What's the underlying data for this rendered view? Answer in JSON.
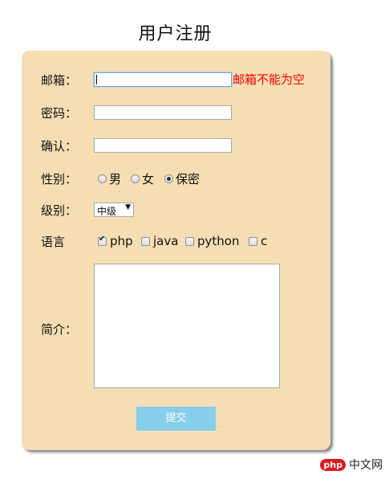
{
  "title": "用户注册",
  "form": {
    "email": {
      "label": "邮箱：",
      "value": "",
      "error": "邮箱不能为空"
    },
    "password": {
      "label": "密码：",
      "value": ""
    },
    "confirm": {
      "label": "确认：",
      "value": ""
    },
    "gender": {
      "label": "性别：",
      "options": [
        {
          "label": "男",
          "checked": false
        },
        {
          "label": "女",
          "checked": false
        },
        {
          "label": "保密",
          "checked": true
        }
      ]
    },
    "level": {
      "label": "级别：",
      "selected": "中级"
    },
    "language": {
      "label": "语言",
      "options": [
        {
          "label": "php",
          "checked": true
        },
        {
          "label": "java",
          "checked": false
        },
        {
          "label": "python",
          "checked": false
        },
        {
          "label": "c",
          "checked": false
        }
      ]
    },
    "bio": {
      "label": "简介：",
      "value": ""
    },
    "submit_label": "提交"
  },
  "watermark": {
    "logo_text": "php",
    "site_text": "中文网"
  },
  "colors": {
    "panel_bg": "#f5deb3",
    "error": "#ff0000",
    "submit_bg": "#87ceeb"
  }
}
